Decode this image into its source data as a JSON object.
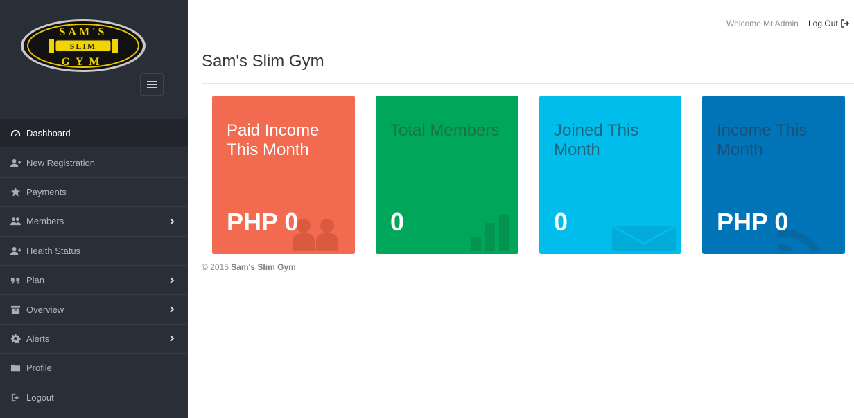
{
  "brand": {
    "logo_top": "SAM'S",
    "logo_middle": "SLIM",
    "logo_bottom": "GYM"
  },
  "sidebar": {
    "items": [
      {
        "label": "Dashboard",
        "icon": "dashboard-icon",
        "active": true
      },
      {
        "label": "New Registration",
        "icon": "user-plus-icon"
      },
      {
        "label": "Payments",
        "icon": "star-icon"
      },
      {
        "label": "Members",
        "icon": "users-icon",
        "has_children": true
      },
      {
        "label": "Health Status",
        "icon": "user-plus-icon"
      },
      {
        "label": "Plan",
        "icon": "quote-icon",
        "has_children": true
      },
      {
        "label": "Overview",
        "icon": "archive-icon",
        "has_children": true
      },
      {
        "label": "Alerts",
        "icon": "gear-icon",
        "has_children": true
      },
      {
        "label": "Profile",
        "icon": "folder-icon"
      },
      {
        "label": "Logout",
        "icon": "sign-out-icon"
      }
    ]
  },
  "header": {
    "welcome": "Welcome Mr.Admin",
    "logout": "Log Out"
  },
  "main": {
    "title": "Sam's Slim Gym",
    "cards": [
      {
        "label": "Paid Income This Month",
        "value": "PHP 0",
        "color": "#f26b51",
        "icon": "users-icon"
      },
      {
        "label": "Total Members",
        "value": "0",
        "color": "#00a65a",
        "icon": "bar-chart-icon"
      },
      {
        "label": "Joined This Month",
        "value": "0",
        "color": "#00bdec",
        "icon": "envelope-icon"
      },
      {
        "label": "Income This Month",
        "value": "PHP 0",
        "color": "#0074b7",
        "icon": "rss-icon"
      }
    ]
  },
  "footer": {
    "copyright": "© 2015",
    "name": "Sam's Slim Gym"
  }
}
